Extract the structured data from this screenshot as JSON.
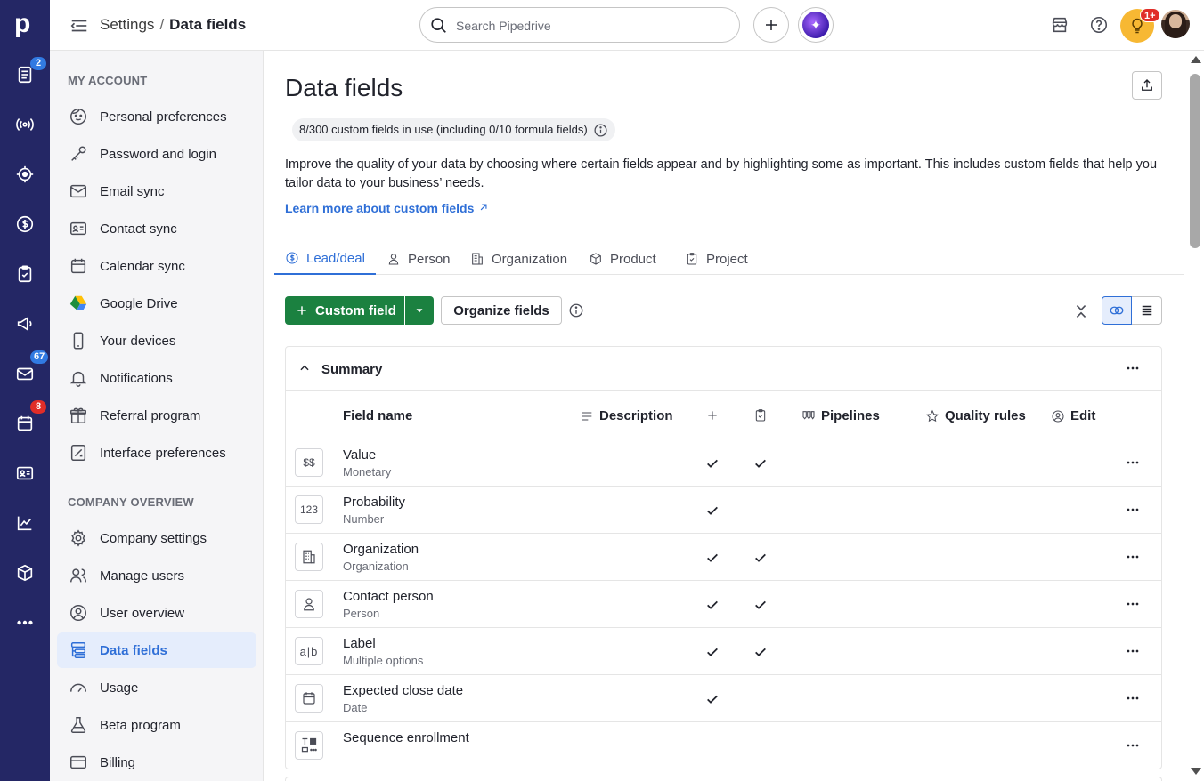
{
  "rail": {
    "logo": "p",
    "items": [
      {
        "name": "deals-icon",
        "badge": "2"
      },
      {
        "name": "leads-icon",
        "badge": ""
      },
      {
        "name": "target-icon",
        "badge": ""
      },
      {
        "name": "dollar-icon",
        "badge": ""
      },
      {
        "name": "activities-icon",
        "badge": ""
      },
      {
        "name": "campaigns-icon",
        "badge": ""
      },
      {
        "name": "mail-icon",
        "badge": "67"
      },
      {
        "name": "calendar-icon",
        "badge": "8"
      },
      {
        "name": "contacts-icon",
        "badge": ""
      },
      {
        "name": "insights-icon",
        "badge": ""
      },
      {
        "name": "products-icon",
        "badge": ""
      },
      {
        "name": "more-icon",
        "badge": ""
      }
    ]
  },
  "topbar": {
    "breadcrumb_parent": "Settings",
    "breadcrumb_sep": "/",
    "breadcrumb_current": "Data fields",
    "search_placeholder": "Search Pipedrive",
    "notif_badge": "1+"
  },
  "sidebar": {
    "my_account_title": "MY ACCOUNT",
    "my_account": [
      {
        "label": "Personal preferences",
        "icon": "face-icon"
      },
      {
        "label": "Password and login",
        "icon": "key-icon"
      },
      {
        "label": "Email sync",
        "icon": "mail-icon"
      },
      {
        "label": "Contact sync",
        "icon": "contact-card-icon"
      },
      {
        "label": "Calendar sync",
        "icon": "calendar-icon"
      },
      {
        "label": "Google Drive",
        "icon": "google-drive-icon"
      },
      {
        "label": "Your devices",
        "icon": "phone-icon"
      },
      {
        "label": "Notifications",
        "icon": "bell-icon"
      },
      {
        "label": "Referral program",
        "icon": "gift-icon"
      },
      {
        "label": "Interface preferences",
        "icon": "interface-icon"
      }
    ],
    "company_title": "COMPANY OVERVIEW",
    "company": [
      {
        "label": "Company settings",
        "icon": "gear-icon"
      },
      {
        "label": "Manage users",
        "icon": "users-icon"
      },
      {
        "label": "User overview",
        "icon": "user-circle-icon"
      },
      {
        "label": "Data fields",
        "icon": "data-fields-icon",
        "active": true
      },
      {
        "label": "Usage",
        "icon": "gauge-icon"
      },
      {
        "label": "Beta program",
        "icon": "flask-icon"
      },
      {
        "label": "Billing",
        "icon": "credit-card-icon"
      }
    ]
  },
  "main": {
    "title": "Data fields",
    "usage": "8/300 custom fields in use (including 0/10 formula fields)",
    "description": "Improve the quality of your data by choosing where certain fields appear and by highlighting some as important. This includes custom fields that help you tailor data to your business’ needs.",
    "learn_more": "Learn more about custom fields",
    "tabs": [
      {
        "label": "Lead/deal",
        "active": true
      },
      {
        "label": "Person"
      },
      {
        "label": "Organization"
      },
      {
        "label": "Product"
      },
      {
        "label": "Project"
      }
    ],
    "custom_field_btn": "Custom field",
    "organize_btn": "Organize fields",
    "summary_title": "Summary",
    "columns": {
      "field_name": "Field name",
      "description": "Description",
      "pipelines": "Pipelines",
      "quality_rules": "Quality rules",
      "edit": "Edit"
    },
    "rows": [
      {
        "name": "Value",
        "type": "Monetary",
        "glyph": "$$",
        "add": true,
        "detail": true
      },
      {
        "name": "Probability",
        "type": "Number",
        "glyph": "123",
        "add": true,
        "detail": false
      },
      {
        "name": "Organization",
        "type": "Organization",
        "glyph": "org",
        "add": true,
        "detail": true
      },
      {
        "name": "Contact person",
        "type": "Person",
        "glyph": "person",
        "add": true,
        "detail": true
      },
      {
        "name": "Label",
        "type": "Multiple options",
        "glyph": "a|b",
        "add": true,
        "detail": true
      },
      {
        "name": "Expected close date",
        "type": "Date",
        "glyph": "date",
        "add": true,
        "detail": false
      },
      {
        "name": "Sequence enrollment",
        "type": "",
        "glyph": "seq",
        "add": false,
        "detail": false
      }
    ]
  }
}
